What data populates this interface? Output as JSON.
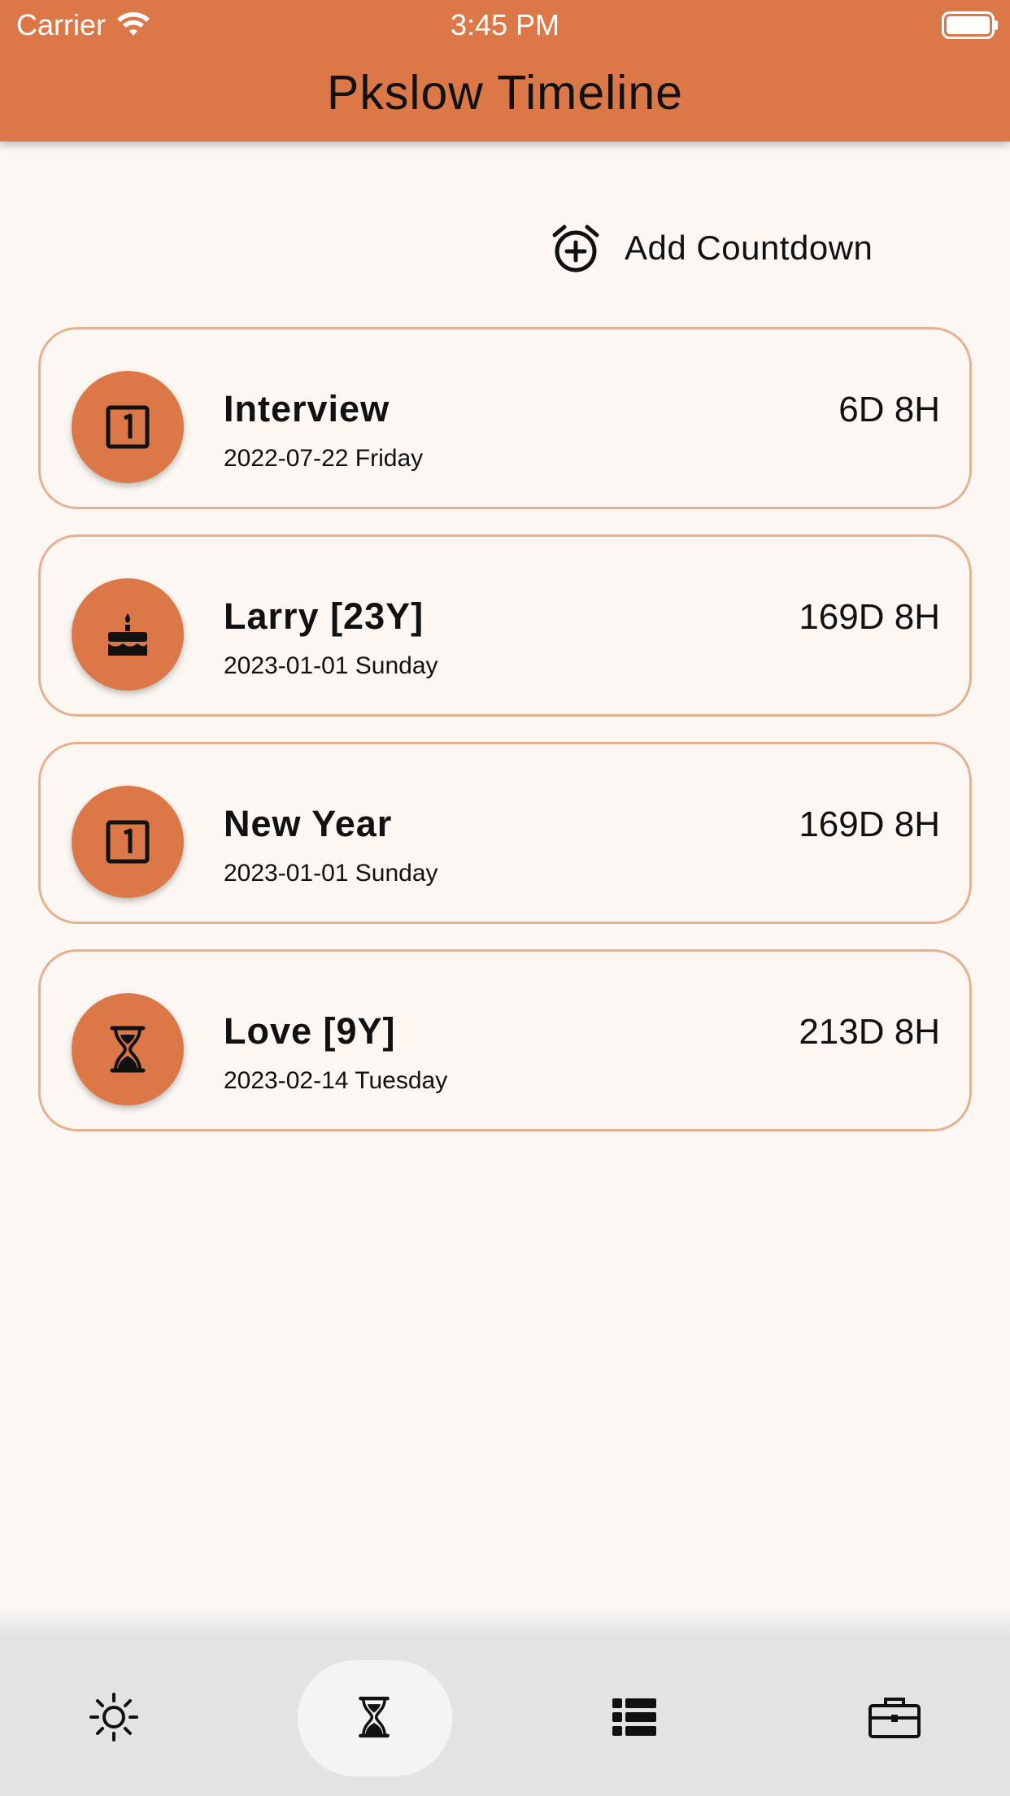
{
  "status_bar": {
    "carrier": "Carrier",
    "time": "3:45 PM"
  },
  "app_bar": {
    "title": "Pkslow Timeline",
    "color": "#dc7848"
  },
  "add_countdown": {
    "label": "Add Countdown",
    "icon": "alarm-add-icon"
  },
  "countdowns": [
    {
      "title": "Interview",
      "date": "2022-07-22 Friday",
      "remaining": "6D 8H",
      "icon": "looks-one-icon"
    },
    {
      "title": "Larry [23Y]",
      "date": "2023-01-01 Sunday",
      "remaining": "169D 8H",
      "icon": "cake-icon"
    },
    {
      "title": "New Year",
      "date": "2023-01-01 Sunday",
      "remaining": "169D 8H",
      "icon": "looks-one-icon"
    },
    {
      "title": "Love [9Y]",
      "date": "2023-02-14 Tuesday",
      "remaining": "213D 8H",
      "icon": "hourglass-icon"
    }
  ],
  "bottom_nav": {
    "items": [
      {
        "icon": "sun-icon",
        "selected": false
      },
      {
        "icon": "hourglass-icon",
        "selected": true
      },
      {
        "icon": "list-icon",
        "selected": false
      },
      {
        "icon": "briefcase-icon",
        "selected": false
      }
    ]
  }
}
